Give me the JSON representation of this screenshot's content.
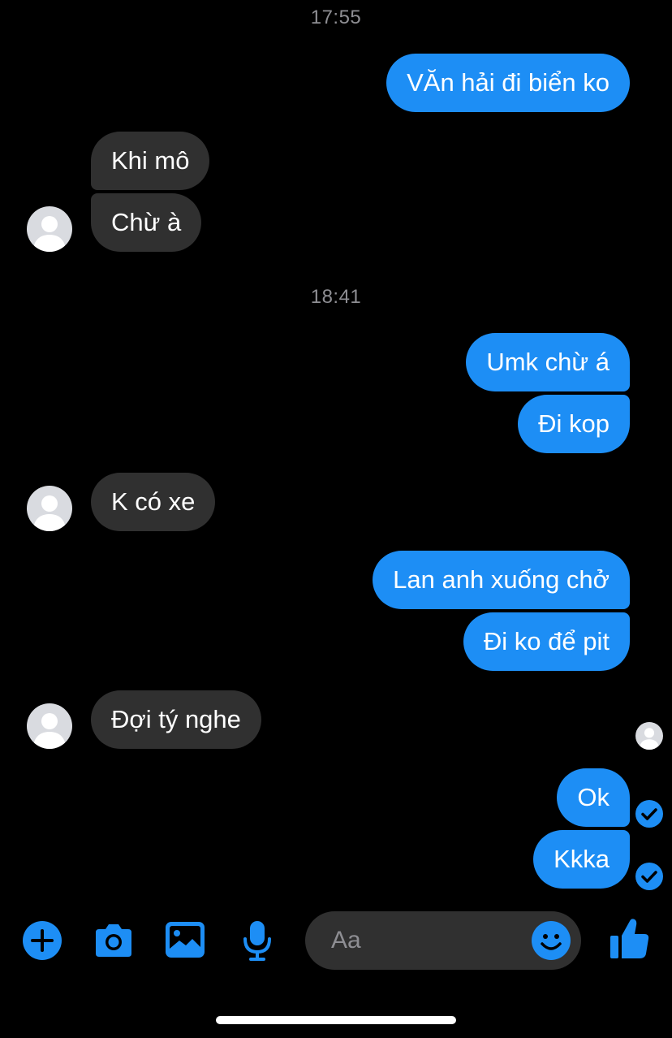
{
  "colors": {
    "background": "#000000",
    "outgoing_bubble": "#1d8ef5",
    "incoming_bubble": "#303030",
    "accent": "#1d8ef5",
    "timestamp_text": "#8e8e93"
  },
  "conversation": {
    "timestamp_1": "17:55",
    "timestamp_2": "18:41",
    "messages": [
      {
        "direction": "out",
        "text": "VĂn hải đi biển ko"
      },
      {
        "direction": "in",
        "text": "Khi mô"
      },
      {
        "direction": "in",
        "text": "Chừ à"
      },
      {
        "direction": "out",
        "text": "Umk chừ á"
      },
      {
        "direction": "out",
        "text": "Đi kop"
      },
      {
        "direction": "in",
        "text": "K có xe"
      },
      {
        "direction": "out",
        "text": "Lan anh xuống chở"
      },
      {
        "direction": "out",
        "text": "Đi ko để pit"
      },
      {
        "direction": "in",
        "text": "Đợi tý nghe"
      },
      {
        "direction": "out",
        "text": "Ok"
      },
      {
        "direction": "out",
        "text": "Kkka"
      }
    ]
  },
  "composer": {
    "placeholder": "Aa",
    "icons": [
      "plus-icon",
      "camera-icon",
      "image-icon",
      "microphone-icon",
      "emoji-icon",
      "thumbs-up-icon"
    ]
  }
}
